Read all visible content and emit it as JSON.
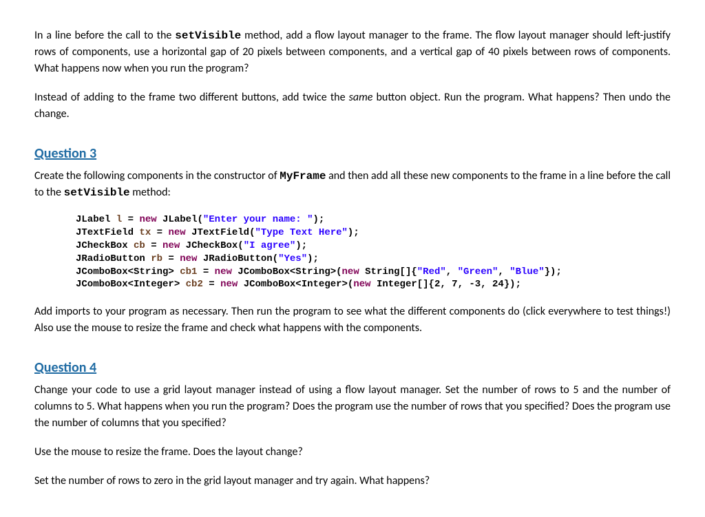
{
  "para1_a": "In a line before the call to the ",
  "para1_code": "setVisible",
  "para1_b": " method, add a flow layout manager to the frame. The flow layout manager should left-justify rows of components, use a horizontal gap of 20 pixels between components, and a vertical gap of 40 pixels between rows of components. What happens now when you run the program?",
  "para2_a": "Instead of adding to the frame two different buttons, add twice the ",
  "para2_same": "same",
  "para2_b": " button object. Run the program. What happens? Then undo the change.",
  "q3_heading": "Question 3",
  "q3_p1_a": "Create the following components in the constructor of ",
  "q3_p1_code1": "MyFrame",
  "q3_p1_b": " and then add all these new components to the frame in a line before the call to the ",
  "q3_p1_code2": "setVisible",
  "q3_p1_c": " method:",
  "code": {
    "l1": {
      "t1": "JLabel ",
      "v": "l",
      "eq": " = ",
      "kw": "new",
      "t2": " JLabel(",
      "s": "\"Enter your name: \"",
      "end": ");"
    },
    "l2": {
      "t1": "JTextField ",
      "v": "tx",
      "eq": " = ",
      "kw": "new",
      "t2": " JTextField(",
      "s": "\"Type Text Here\"",
      "end": ");"
    },
    "l3": {
      "t1": "JCheckBox ",
      "v": "cb",
      "eq": " = ",
      "kw": "new",
      "t2": " JCheckBox(",
      "s": "\"I agree\"",
      "end": ");"
    },
    "l4": {
      "t1": "JRadioButton ",
      "v": "rb",
      "eq": " = ",
      "kw": "new",
      "t2": " JRadioButton(",
      "s": "\"Yes\"",
      "end": ");"
    },
    "l5": {
      "t1": "JComboBox<String> ",
      "v": "cb1",
      "eq": " = ",
      "kw": "new",
      "t2": " JComboBox<String>(",
      "kw2": "new",
      "t3": " String[]{",
      "s1": "\"Red\"",
      "c1": ", ",
      "s2": "\"Green\"",
      "c2": ", ",
      "s3": "\"Blue\"",
      "end": "});"
    },
    "l6": {
      "t1": "JComboBox<Integer> ",
      "v": "cb2",
      "eq": " = ",
      "kw": "new",
      "t2": " JComboBox<Integer>(",
      "kw2": "new",
      "t3": " Integer[]{2, 7, -3, 24});"
    }
  },
  "q3_p2": "Add imports to your program as necessary. Then run the program to see what the different components do (click everywhere to test things!) Also use the mouse to resize the frame and check what happens with the components.",
  "q4_heading": "Question 4",
  "q4_p1": "Change your code to use a grid layout manager instead of using a flow layout manager. Set the number of rows to 5 and the number of columns to 5. What happens when you run the program? Does the program use the number of rows that you specified? Does the program use the number of columns that you specified?",
  "q4_p2": "Use the mouse to resize the frame. Does the layout change?",
  "q4_p3": "Set the number of rows to zero in the grid layout manager and try again. What happens?"
}
